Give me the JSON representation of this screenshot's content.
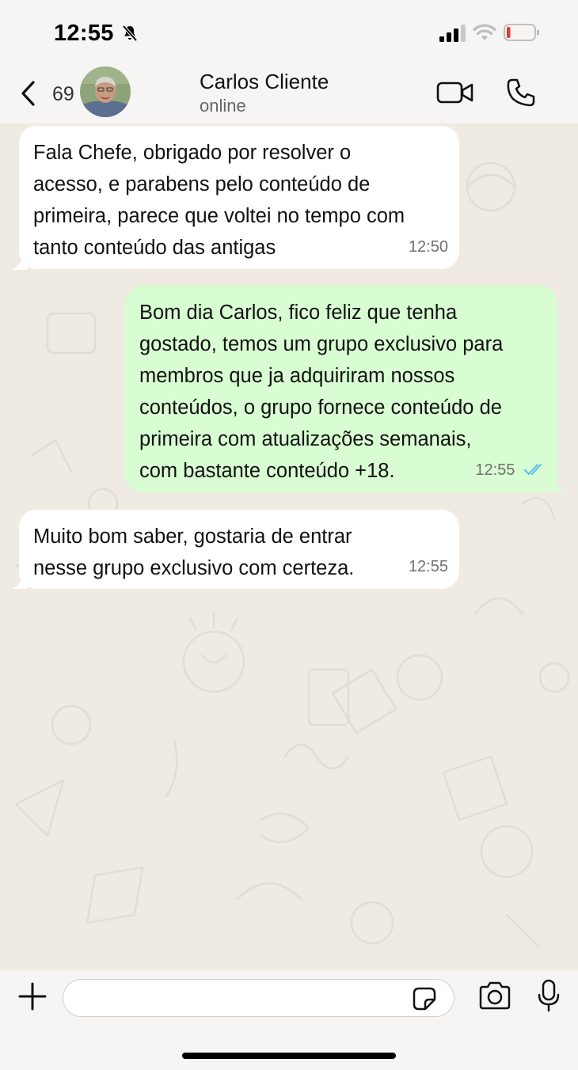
{
  "status_bar": {
    "time": "12:55",
    "icons": [
      "bell-slash-icon",
      "cellular-signal-icon",
      "wifi-icon",
      "battery-low-icon"
    ]
  },
  "header": {
    "unread_count": "69",
    "contact_name": "Carlos Cliente",
    "contact_status": "online",
    "icons": [
      "chevron-left-icon",
      "video-camera-icon",
      "phone-icon"
    ]
  },
  "messages": [
    {
      "direction": "incoming",
      "text": "Fala Chefe, obrigado por resolver o\nacesso, e parabens pelo conteúdo de\nprimeira, parece que voltei no tempo com\ntanto conteúdo das antigas",
      "time": "12:50"
    },
    {
      "direction": "outgoing",
      "text": "Bom dia Carlos, fico feliz que tenha\ngostado, temos um grupo exclusivo para\nmembros que ja adquiriram nossos\nconteúdos, o grupo fornece conteúdo de\nprimeira com atualizações semanais,\ncom bastante conteúdo +18.",
      "time": "12:55",
      "read": true
    },
    {
      "direction": "incoming",
      "text": "Muito bom saber, gostaria de entrar\nnesse grupo exclusivo com certeza.",
      "time": "12:55"
    }
  ],
  "composer": {
    "input_value": "",
    "icons": [
      "plus-icon",
      "sticker-icon",
      "camera-icon",
      "microphone-icon"
    ]
  },
  "colors": {
    "chat_background": "#efeae2",
    "incoming_bubble": "#ffffff",
    "outgoing_bubble": "#d8fdd2",
    "read_checks": "#53bdeb",
    "battery_low": "#e53935"
  }
}
